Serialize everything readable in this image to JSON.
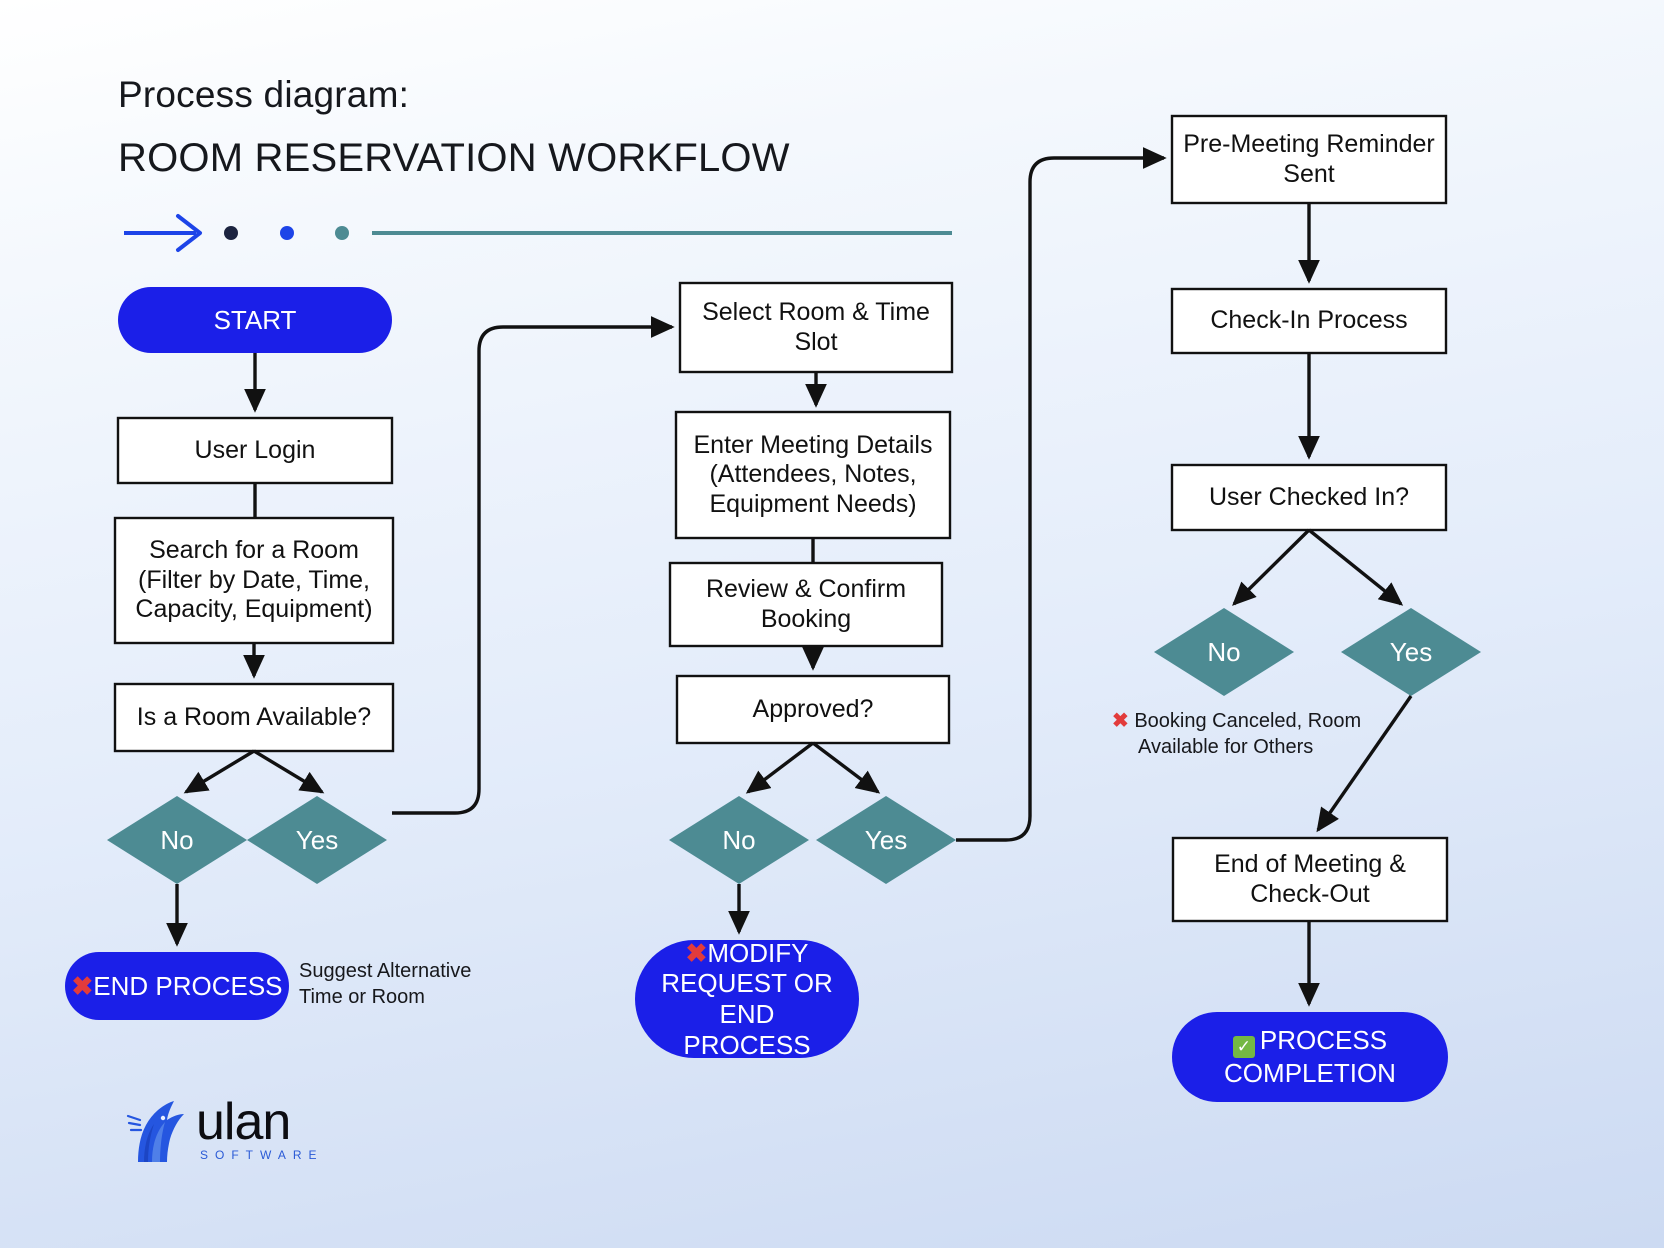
{
  "header": {
    "eyebrow": "Process diagram:",
    "title": "ROOM RESERVATION WORKFLOW"
  },
  "decoration": {
    "arrow_icon": "long-arrow-right-icon",
    "dots": [
      "#1c2440",
      "#1d44e8",
      "#4d8b93"
    ],
    "rule_color": "#4d8b93",
    "arrow_color": "#1d44e8"
  },
  "palette": {
    "pill_blue": "#1b1fe8",
    "diamond_teal": "#4d8b93",
    "box_fill": "#ffffff",
    "stroke": "#111111",
    "x_red": "#e23b3b",
    "check_green": "#74b843"
  },
  "columns": {
    "left": {
      "start": {
        "label": "START"
      },
      "steps": [
        {
          "lines": [
            "User Login"
          ]
        },
        {
          "lines": [
            "Search for a Room",
            "(Filter by Date, Time,",
            "Capacity, Equipment)"
          ]
        },
        {
          "lines": [
            "Is a Room Available?"
          ]
        }
      ],
      "decisions": [
        {
          "label": "No"
        },
        {
          "label": "Yes"
        }
      ],
      "terminator": {
        "x_icon": "x-mark-icon",
        "label": "END PROCESS"
      },
      "annotation": {
        "lines": [
          "Suggest Alternative",
          "Time or Room"
        ]
      }
    },
    "middle": {
      "steps": [
        {
          "lines": [
            "Select Room & Time",
            "Slot"
          ]
        },
        {
          "lines": [
            "Enter Meeting Details",
            "(Attendees, Notes,",
            "Equipment Needs)"
          ]
        },
        {
          "lines": [
            "Review & Confirm",
            "Booking"
          ]
        },
        {
          "lines": [
            "Approved?"
          ]
        }
      ],
      "decisions": [
        {
          "label": "No"
        },
        {
          "label": "Yes"
        }
      ],
      "terminator": {
        "x_icon": "x-mark-icon",
        "lines": [
          "MODIFY",
          "REQUEST OR END",
          "PROCESS"
        ]
      }
    },
    "right": {
      "steps": [
        {
          "lines": [
            "Pre-Meeting Reminder",
            "Sent"
          ]
        },
        {
          "lines": [
            "Check-In Process"
          ]
        },
        {
          "lines": [
            "User Checked In?"
          ]
        }
      ],
      "decisions": [
        {
          "label": "No"
        },
        {
          "label": "Yes"
        }
      ],
      "annotation": {
        "x_icon": "x-mark-icon",
        "lines": [
          "Booking Canceled, Room",
          "Available for Others"
        ]
      },
      "step_after": {
        "lines": [
          "End of Meeting &",
          "Check-Out"
        ]
      },
      "terminator": {
        "check_icon": "check-mark-icon",
        "lines": [
          "PROCESS",
          "COMPLETION"
        ]
      }
    }
  },
  "logo": {
    "icon": "unicorn-logo-icon",
    "wordmark": "ulan",
    "tagline": "SOFTWARE"
  }
}
